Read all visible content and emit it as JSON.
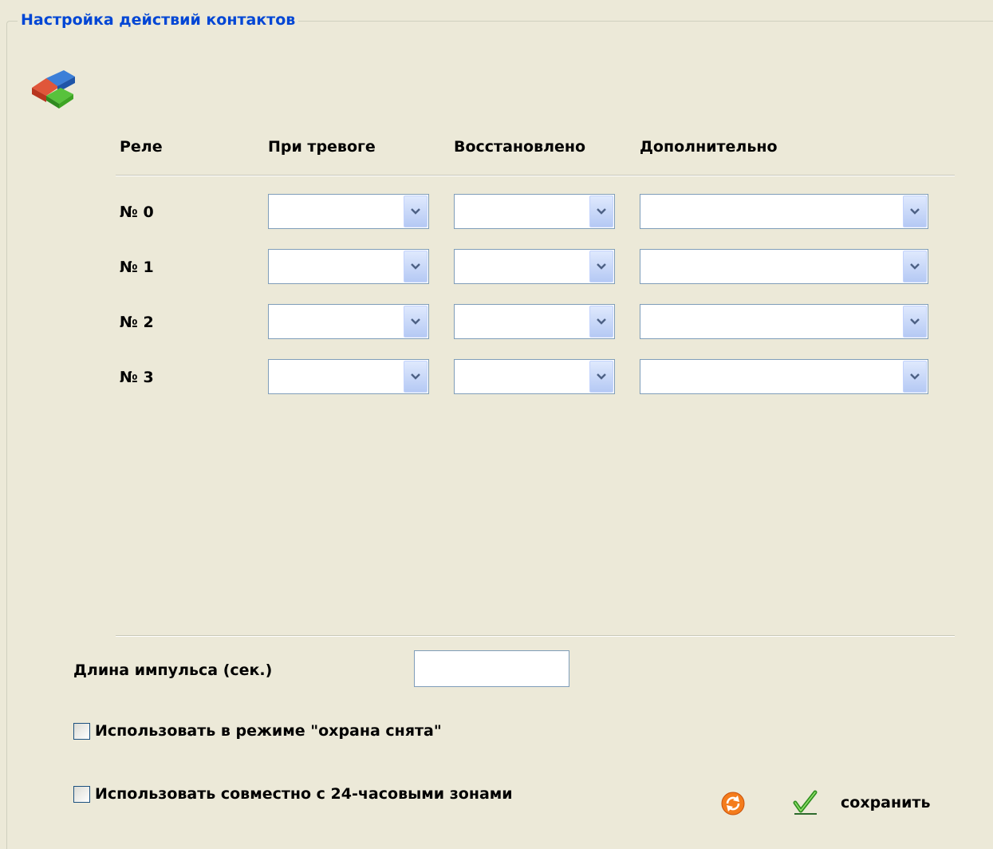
{
  "groupbox": {
    "title": "Настройка действий контактов"
  },
  "table": {
    "headers": [
      "Реле",
      "При тревоге",
      "Восстановлено",
      "Дополнительно"
    ],
    "rows": [
      {
        "label": "№ 0",
        "alarm": "",
        "restored": "",
        "extra": ""
      },
      {
        "label": "№ 1",
        "alarm": "",
        "restored": "",
        "extra": ""
      },
      {
        "label": "№ 2",
        "alarm": "",
        "restored": "",
        "extra": ""
      },
      {
        "label": "№ 3",
        "alarm": "",
        "restored": "",
        "extra": ""
      }
    ]
  },
  "pulse": {
    "label": "Длина импульса (сек.)",
    "value": ""
  },
  "options": {
    "disarmed_label": "Использовать в режиме \"охрана снята\"",
    "disarmed_checked": false,
    "zones24_label": "Использовать совместно с 24-часовыми зонами",
    "zones24_checked": false
  },
  "actions": {
    "save_label": "сохранить"
  },
  "colors": {
    "background": "#ece9d8",
    "legend": "#0046d5",
    "combo_border": "#7f9db9"
  }
}
